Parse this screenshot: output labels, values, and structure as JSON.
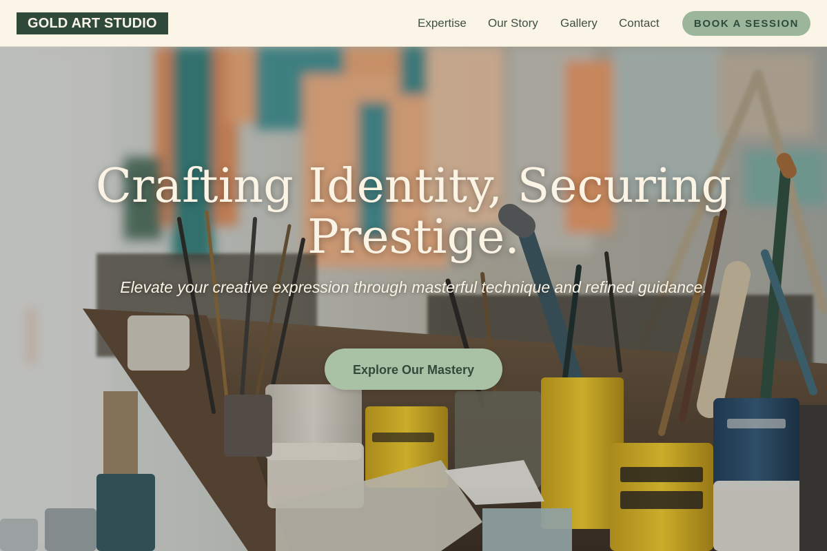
{
  "header": {
    "logo_text": "GOLD ART STUDIO",
    "nav": [
      {
        "label": "Expertise"
      },
      {
        "label": "Our Story"
      },
      {
        "label": "Gallery"
      },
      {
        "label": "Contact"
      }
    ],
    "cta_label": "BOOK A SESSION"
  },
  "hero": {
    "title": "Crafting Identity, Securing Prestige.",
    "subtitle": "Elevate your creative expression through masterful technique and refined guidance.",
    "cta_label": "Explore Our Mastery",
    "background_image": "art-studio-paint-brushes-photo"
  },
  "colors": {
    "header_bg": "#fbf5e8",
    "logo_bg": "#2f4a3b",
    "accent_sage": "#9bb69a",
    "text_dark_green": "#2f4a3b",
    "hero_text": "#fbf3e4"
  }
}
